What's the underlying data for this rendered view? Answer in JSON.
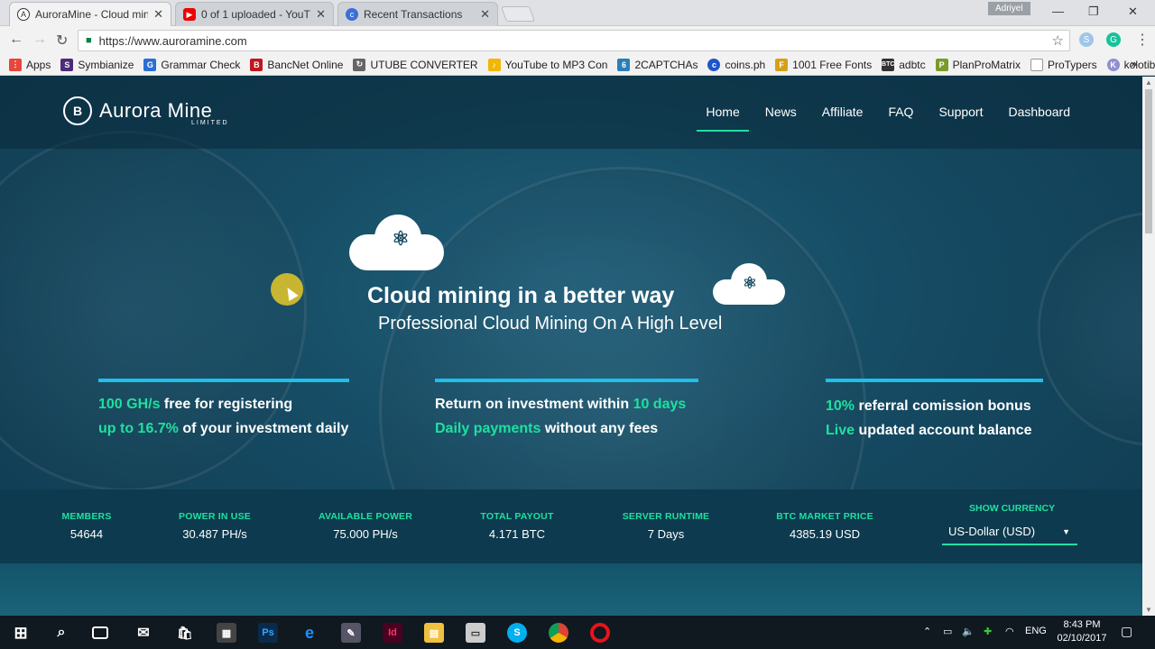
{
  "browser": {
    "tabs": [
      {
        "title": "AuroraMine - Cloud mini",
        "active": true
      },
      {
        "title": "0 of 1 uploaded - YouTu",
        "active": false
      },
      {
        "title": "Recent Transactions",
        "active": false
      }
    ],
    "user": "Adriyel",
    "url": "https://www.auroramine.com",
    "bookmarks": [
      "Apps",
      "Symbianize",
      "Grammar Check",
      "BancNet Online",
      "UTUBE CONVERTER",
      "YouTube to MP3 Con",
      "2CAPTCHAs",
      "coins.ph",
      "1001 Free Fonts",
      "adbtc",
      "PlanProMatrix",
      "ProTypers",
      "kolotibablo"
    ],
    "bookmark_more": "»"
  },
  "site": {
    "logo": {
      "name": "Aurora Mine",
      "sub": "LIMITED"
    },
    "nav": [
      "Home",
      "News",
      "Affiliate",
      "FAQ",
      "Support",
      "Dashboard"
    ],
    "hero": {
      "title": "Cloud mining in a better way",
      "subtitle": "Professional Cloud Mining On A High Level"
    },
    "features": [
      {
        "line1_hl": "100 GH/s",
        "line1": " free for registering",
        "line2_hl": "up to 16.7%",
        "line2": " of your investment daily"
      },
      {
        "line1": "Return on investment within ",
        "line1_hl": "10 days",
        "line2_hl": "Daily payments",
        "line2": " without any fees"
      },
      {
        "line1_hl": "10%",
        "line1": " referral comission bonus",
        "line2_hl": "Live",
        "line2": " updated account balance"
      }
    ],
    "stats": [
      {
        "label": "MEMBERS",
        "value": "54644"
      },
      {
        "label": "POWER IN USE",
        "value": "30.487 PH/s"
      },
      {
        "label": "AVAILABLE POWER",
        "value": "75.000 PH/s"
      },
      {
        "label": "TOTAL PAYOUT",
        "value": "4.171 BTC"
      },
      {
        "label": "SERVER RUNTIME",
        "value": "7 Days"
      },
      {
        "label": "BTC MARKET PRICE",
        "value": "4385.19 USD"
      }
    ],
    "currency": {
      "label": "SHOW CURRENCY",
      "selected": "US-Dollar (USD)"
    }
  },
  "taskbar": {
    "language": "ENG",
    "time": "8:43 PM",
    "date": "02/10/2017"
  },
  "colors": {
    "accent": "#1fe0a0",
    "bar": "#1fc0e8",
    "bg": "#154a62"
  }
}
